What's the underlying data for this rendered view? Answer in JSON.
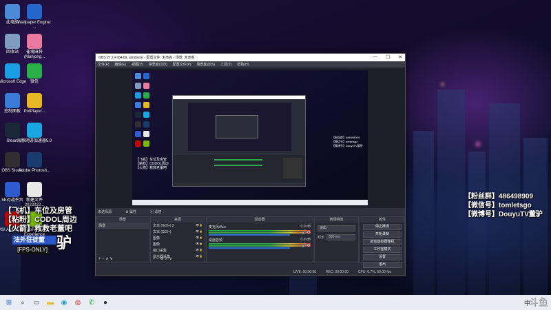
{
  "desktop_icons": [
    {
      "label": "此电脑",
      "icon": "computer-icon",
      "color": "#4a8ad6"
    },
    {
      "label": "Wallpaper Engine: ...",
      "icon": "wallpaper-engine-icon",
      "color": "#2466c9"
    },
    {
      "label": "回收站",
      "icon": "recycle-bin-icon",
      "color": "#7f9bbf"
    },
    {
      "label": "雀魂麻将 (Mahjong...",
      "icon": "mahjong-soul-icon",
      "color": "#e87aa0"
    },
    {
      "label": "Microsoft Edge",
      "icon": "edge-icon",
      "color": "#1b9de2"
    },
    {
      "label": "微信",
      "icon": "wechat-icon",
      "color": "#2aae47"
    },
    {
      "label": "控制面板",
      "icon": "control-panel-icon",
      "color": "#3b7bd8"
    },
    {
      "label": "PotPlayer...",
      "icon": "potplayer-icon",
      "color": "#e7b723"
    },
    {
      "label": "Steam",
      "icon": "steam-icon",
      "color": "#1b2838"
    },
    {
      "label": "海豚网游加速器5.0",
      "icon": "accelerator-icon",
      "color": "#18a7e0"
    },
    {
      "label": "OBS Studio",
      "icon": "obs-icon",
      "color": "#302e31"
    },
    {
      "label": "Adobe Photosh...",
      "icon": "photoshop-icon",
      "color": "#1a3b6e"
    },
    {
      "label": "5E对战平台",
      "icon": "5e-platform-icon",
      "color": "#2d5bd0"
    },
    {
      "label": "新建文件 2022022...",
      "icon": "new-file-icon",
      "color": "#e8e8e8"
    },
    {
      "label": "MSI Afterburner",
      "icon": "afterburner-icon",
      "color": "#b00"
    },
    {
      "label": "GeForce Experience",
      "icon": "geforce-icon",
      "color": "#76b900"
    }
  ],
  "overlay_left": {
    "line1": "【飞机】车位及房管",
    "line2": "【粘粉】CODOL周边",
    "line3": "【火箭】救救老董吧",
    "badge_main": "法外狂徒董",
    "badge_sub": "[FPS-ONLY]",
    "brush_char": "驴"
  },
  "overlay_right": {
    "line1": "【粉丝群】486498909",
    "line2": "【微信号】tomletsgo",
    "line3": "【微博号】DouyuTV董驴"
  },
  "obs": {
    "title": "OBS 27.2.4 (64-bit, windows) - 配置文件: 未命名 - 场景: 未命名",
    "menu": [
      "文件(F)",
      "编辑(E)",
      "视图(V)",
      "停靠窗口(D)",
      "配置文件(P)",
      "场景集合(S)",
      "工具(T)",
      "帮助(H)"
    ],
    "source_bar": {
      "label": "未选择源",
      "properties": "属性",
      "filters": "滤镜"
    },
    "docks": {
      "scenes": {
        "header": "场景",
        "items": [
          "场景"
        ]
      },
      "sources": {
        "header": "来源",
        "items": [
          "文本 (GDI+) 2",
          "文本 (GDI+)",
          "图像",
          "图像",
          "窗口采集",
          "显示器采集"
        ]
      },
      "mixer": {
        "header": "混音器",
        "channels": [
          {
            "name": "麦克风/Aux",
            "db": "0.0 dB"
          },
          {
            "name": "桌面音频",
            "db": "0.0 dB"
          }
        ]
      },
      "transitions": {
        "header": "转场特效",
        "type": "淡出",
        "duration_label": "时长",
        "duration": "300 ms"
      },
      "controls": {
        "header": "控件",
        "buttons": [
          "停止推流",
          "开始录制",
          "启动虚拟摄像机",
          "工作室模式",
          "设置",
          "退出"
        ]
      }
    },
    "status": {
      "live": "LIVE: 00:00:00",
      "rec": "REC: 00:00:00",
      "cpu": "CPU: 0.7%, 60.00 fps"
    }
  },
  "taskbar_icons": [
    "windows-start-icon",
    "search-icon",
    "task-view-icon",
    "file-explorer-icon",
    "edge-icon",
    "chrome-icon",
    "wechat-icon",
    "obs-icon"
  ],
  "tray": {
    "lang": "中",
    "watermark": "斗鱼"
  }
}
